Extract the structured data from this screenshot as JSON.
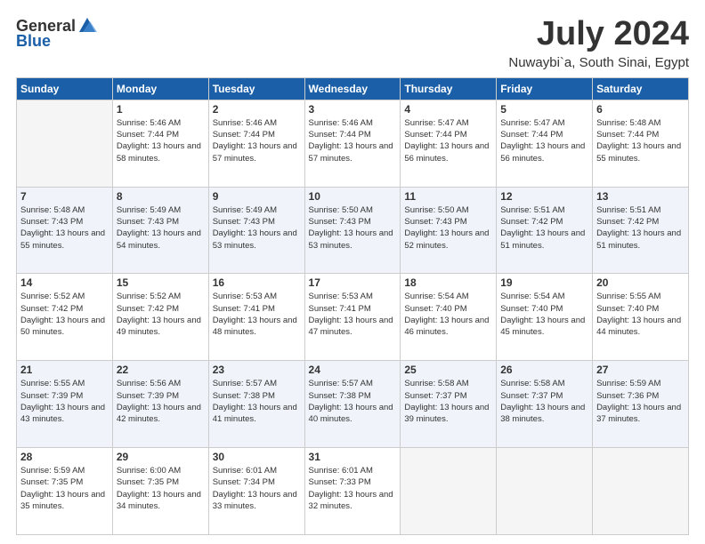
{
  "logo": {
    "general": "General",
    "blue": "Blue"
  },
  "header": {
    "month": "July 2024",
    "location": "Nuwaybi`a, South Sinai, Egypt"
  },
  "weekdays": [
    "Sunday",
    "Monday",
    "Tuesday",
    "Wednesday",
    "Thursday",
    "Friday",
    "Saturday"
  ],
  "weeks": [
    [
      {
        "day": "",
        "sunrise": "",
        "sunset": "",
        "daylight": ""
      },
      {
        "day": "1",
        "sunrise": "Sunrise: 5:46 AM",
        "sunset": "Sunset: 7:44 PM",
        "daylight": "Daylight: 13 hours and 58 minutes."
      },
      {
        "day": "2",
        "sunrise": "Sunrise: 5:46 AM",
        "sunset": "Sunset: 7:44 PM",
        "daylight": "Daylight: 13 hours and 57 minutes."
      },
      {
        "day": "3",
        "sunrise": "Sunrise: 5:46 AM",
        "sunset": "Sunset: 7:44 PM",
        "daylight": "Daylight: 13 hours and 57 minutes."
      },
      {
        "day": "4",
        "sunrise": "Sunrise: 5:47 AM",
        "sunset": "Sunset: 7:44 PM",
        "daylight": "Daylight: 13 hours and 56 minutes."
      },
      {
        "day": "5",
        "sunrise": "Sunrise: 5:47 AM",
        "sunset": "Sunset: 7:44 PM",
        "daylight": "Daylight: 13 hours and 56 minutes."
      },
      {
        "day": "6",
        "sunrise": "Sunrise: 5:48 AM",
        "sunset": "Sunset: 7:44 PM",
        "daylight": "Daylight: 13 hours and 55 minutes."
      }
    ],
    [
      {
        "day": "7",
        "sunrise": "Sunrise: 5:48 AM",
        "sunset": "Sunset: 7:43 PM",
        "daylight": "Daylight: 13 hours and 55 minutes."
      },
      {
        "day": "8",
        "sunrise": "Sunrise: 5:49 AM",
        "sunset": "Sunset: 7:43 PM",
        "daylight": "Daylight: 13 hours and 54 minutes."
      },
      {
        "day": "9",
        "sunrise": "Sunrise: 5:49 AM",
        "sunset": "Sunset: 7:43 PM",
        "daylight": "Daylight: 13 hours and 53 minutes."
      },
      {
        "day": "10",
        "sunrise": "Sunrise: 5:50 AM",
        "sunset": "Sunset: 7:43 PM",
        "daylight": "Daylight: 13 hours and 53 minutes."
      },
      {
        "day": "11",
        "sunrise": "Sunrise: 5:50 AM",
        "sunset": "Sunset: 7:43 PM",
        "daylight": "Daylight: 13 hours and 52 minutes."
      },
      {
        "day": "12",
        "sunrise": "Sunrise: 5:51 AM",
        "sunset": "Sunset: 7:42 PM",
        "daylight": "Daylight: 13 hours and 51 minutes."
      },
      {
        "day": "13",
        "sunrise": "Sunrise: 5:51 AM",
        "sunset": "Sunset: 7:42 PM",
        "daylight": "Daylight: 13 hours and 51 minutes."
      }
    ],
    [
      {
        "day": "14",
        "sunrise": "Sunrise: 5:52 AM",
        "sunset": "Sunset: 7:42 PM",
        "daylight": "Daylight: 13 hours and 50 minutes."
      },
      {
        "day": "15",
        "sunrise": "Sunrise: 5:52 AM",
        "sunset": "Sunset: 7:42 PM",
        "daylight": "Daylight: 13 hours and 49 minutes."
      },
      {
        "day": "16",
        "sunrise": "Sunrise: 5:53 AM",
        "sunset": "Sunset: 7:41 PM",
        "daylight": "Daylight: 13 hours and 48 minutes."
      },
      {
        "day": "17",
        "sunrise": "Sunrise: 5:53 AM",
        "sunset": "Sunset: 7:41 PM",
        "daylight": "Daylight: 13 hours and 47 minutes."
      },
      {
        "day": "18",
        "sunrise": "Sunrise: 5:54 AM",
        "sunset": "Sunset: 7:40 PM",
        "daylight": "Daylight: 13 hours and 46 minutes."
      },
      {
        "day": "19",
        "sunrise": "Sunrise: 5:54 AM",
        "sunset": "Sunset: 7:40 PM",
        "daylight": "Daylight: 13 hours and 45 minutes."
      },
      {
        "day": "20",
        "sunrise": "Sunrise: 5:55 AM",
        "sunset": "Sunset: 7:40 PM",
        "daylight": "Daylight: 13 hours and 44 minutes."
      }
    ],
    [
      {
        "day": "21",
        "sunrise": "Sunrise: 5:55 AM",
        "sunset": "Sunset: 7:39 PM",
        "daylight": "Daylight: 13 hours and 43 minutes."
      },
      {
        "day": "22",
        "sunrise": "Sunrise: 5:56 AM",
        "sunset": "Sunset: 7:39 PM",
        "daylight": "Daylight: 13 hours and 42 minutes."
      },
      {
        "day": "23",
        "sunrise": "Sunrise: 5:57 AM",
        "sunset": "Sunset: 7:38 PM",
        "daylight": "Daylight: 13 hours and 41 minutes."
      },
      {
        "day": "24",
        "sunrise": "Sunrise: 5:57 AM",
        "sunset": "Sunset: 7:38 PM",
        "daylight": "Daylight: 13 hours and 40 minutes."
      },
      {
        "day": "25",
        "sunrise": "Sunrise: 5:58 AM",
        "sunset": "Sunset: 7:37 PM",
        "daylight": "Daylight: 13 hours and 39 minutes."
      },
      {
        "day": "26",
        "sunrise": "Sunrise: 5:58 AM",
        "sunset": "Sunset: 7:37 PM",
        "daylight": "Daylight: 13 hours and 38 minutes."
      },
      {
        "day": "27",
        "sunrise": "Sunrise: 5:59 AM",
        "sunset": "Sunset: 7:36 PM",
        "daylight": "Daylight: 13 hours and 37 minutes."
      }
    ],
    [
      {
        "day": "28",
        "sunrise": "Sunrise: 5:59 AM",
        "sunset": "Sunset: 7:35 PM",
        "daylight": "Daylight: 13 hours and 35 minutes."
      },
      {
        "day": "29",
        "sunrise": "Sunrise: 6:00 AM",
        "sunset": "Sunset: 7:35 PM",
        "daylight": "Daylight: 13 hours and 34 minutes."
      },
      {
        "day": "30",
        "sunrise": "Sunrise: 6:01 AM",
        "sunset": "Sunset: 7:34 PM",
        "daylight": "Daylight: 13 hours and 33 minutes."
      },
      {
        "day": "31",
        "sunrise": "Sunrise: 6:01 AM",
        "sunset": "Sunset: 7:33 PM",
        "daylight": "Daylight: 13 hours and 32 minutes."
      },
      {
        "day": "",
        "sunrise": "",
        "sunset": "",
        "daylight": ""
      },
      {
        "day": "",
        "sunrise": "",
        "sunset": "",
        "daylight": ""
      },
      {
        "day": "",
        "sunrise": "",
        "sunset": "",
        "daylight": ""
      }
    ]
  ]
}
